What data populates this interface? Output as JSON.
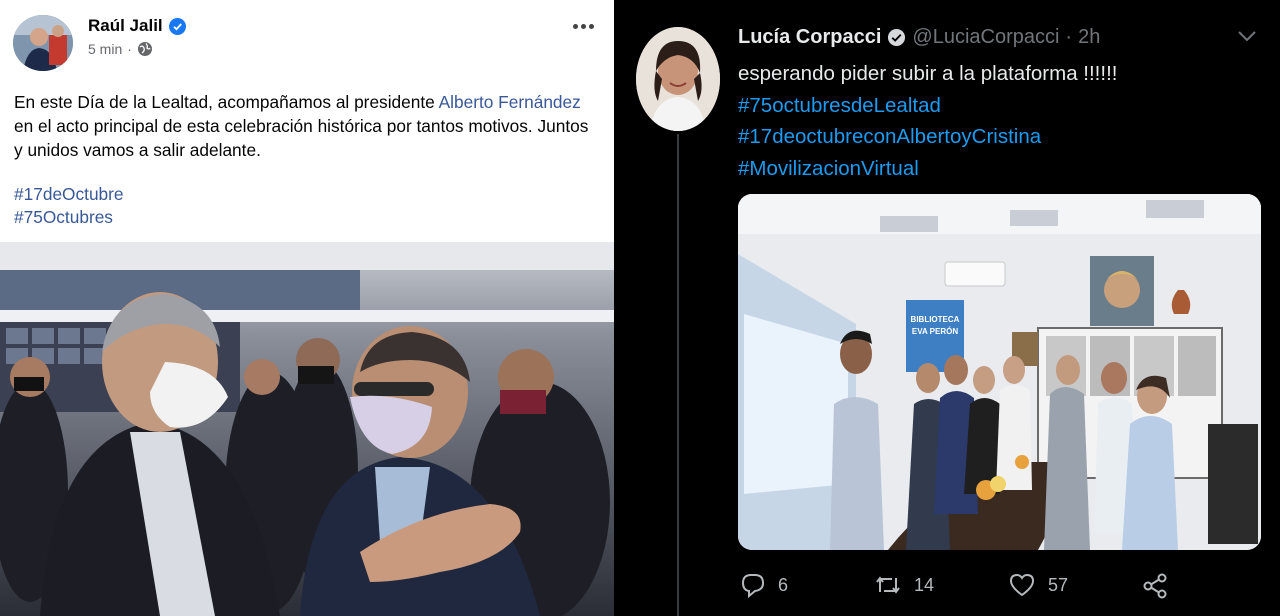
{
  "facebook_post": {
    "author_name": "Raúl Jalil",
    "time": "5 min",
    "separator": "·",
    "text_before": "En este Día de la Lealtad, acompañamos al presidente ",
    "mention": "Alberto Fernández",
    "text_after": " en el acto principal de esta celebración histórica por tantos motivos. Juntos y unidos vamos a salir adelante.",
    "hashtags": [
      "#17deOctubre",
      "#75Octubres"
    ]
  },
  "tweet": {
    "author_name": "Lucía Corpacci",
    "handle": "@LuciaCorpacci",
    "separator": "·",
    "time": "2h",
    "lines": [
      "esperando pider subir a la plataforma !!!!!!"
    ],
    "hashtags": [
      "#75octubresdeLealtad",
      "#17deoctubreconAlbertoyCristina",
      "#MovilizacionVirtual"
    ],
    "poster_text": [
      "BIBLIOTECA",
      "EVA PERÓN"
    ],
    "actions": {
      "reply_count": "6",
      "retweet_count": "14",
      "like_count": "57"
    }
  },
  "colors": {
    "facebook_link": "#385898",
    "twitter_link": "#1d9bf0",
    "verified_blue": "#1877f2",
    "twitter_bg": "#000000"
  }
}
